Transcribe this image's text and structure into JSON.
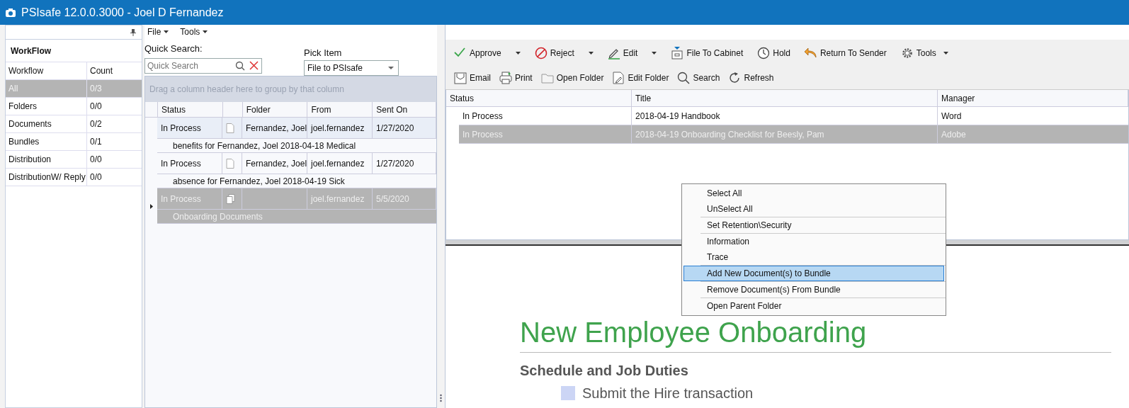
{
  "window": {
    "title": "PSIsafe 12.0.0.3000 - Joel D Fernandez"
  },
  "workflow_panel": {
    "title": "WorkFlow",
    "columns": [
      "Workflow",
      "Count"
    ],
    "rows": [
      {
        "name": "All",
        "count": "0/3",
        "selected": true
      },
      {
        "name": "Folders",
        "count": "0/0",
        "selected": false
      },
      {
        "name": "Documents",
        "count": "0/2",
        "selected": false
      },
      {
        "name": "Bundles",
        "count": "0/1",
        "selected": false
      },
      {
        "name": "Distribution",
        "count": "0/0",
        "selected": false
      },
      {
        "name": "DistributionW/ Reply",
        "count": "0/0",
        "selected": false
      }
    ]
  },
  "menu": [
    {
      "label": "File"
    },
    {
      "label": "Tools"
    }
  ],
  "quick_search": {
    "label": "Quick Search:",
    "placeholder": "Quick Search"
  },
  "pick_item": {
    "label": "Pick Item",
    "value": "File to PSIsafe"
  },
  "inbox_grid": {
    "group_hint": "Drag a column header here to group by that column",
    "columns": [
      "Status",
      "Folder",
      "From",
      "Sent On"
    ],
    "rows": [
      {
        "kind": "document",
        "status": "In Process",
        "folder": "Fernandez, Joel",
        "from": "joel.fernandez",
        "sent_on": "1/27/2020",
        "description": "benefits for Fernandez, Joel 2018-04-18 Medical",
        "focused": true,
        "selected": false
      },
      {
        "kind": "document",
        "status": "In Process",
        "folder": "Fernandez, Joel",
        "from": "joel.fernandez",
        "sent_on": "1/27/2020",
        "description": "absence for Fernandez, Joel 2018-04-19 Sick",
        "focused": false,
        "selected": false
      },
      {
        "kind": "bundle",
        "status": "In Process",
        "from": "joel.fernandez",
        "sent_on": "5/5/2020",
        "description": "Onboarding Documents",
        "focused": false,
        "selected": true
      }
    ]
  },
  "toolbar": [
    {
      "label": "Approve",
      "dropdown": true
    },
    {
      "label": "Reject",
      "dropdown": true
    },
    {
      "label": "Edit",
      "dropdown": true
    },
    {
      "label": "File To Cabinet",
      "dropdown": false
    },
    {
      "label": "Hold",
      "dropdown": false
    },
    {
      "label": "Return To Sender",
      "dropdown": false
    },
    {
      "label": "Tools",
      "dropdown": true
    }
  ],
  "toolbar_2": [
    {
      "label": "Email"
    },
    {
      "label": "Print"
    },
    {
      "label": "Open Folder"
    },
    {
      "label": "Edit Folder"
    },
    {
      "label": "Search"
    },
    {
      "label": "Refresh"
    }
  ],
  "documents_grid": {
    "columns": [
      "Status",
      "Title",
      "Manager"
    ],
    "rows": [
      {
        "status": "In Process",
        "title": "2018-04-19 Handbook",
        "manager": "Word",
        "selected": false
      },
      {
        "status": "In Process",
        "title": "2018-04-19 Onboarding Checklist for Beesly, Pam",
        "manager": "Adobe",
        "selected": true
      }
    ]
  },
  "preview": {
    "heading": "New Employee Onboarding",
    "subheading": "Schedule and Job Duties",
    "items": [
      {
        "text": "Submit the Hire transaction",
        "checked": false
      }
    ]
  },
  "context_menu": {
    "groups": [
      {
        "items": [
          {
            "label": "Select All",
            "selected": false
          },
          {
            "label": "UnSelect All",
            "selected": false
          }
        ]
      },
      {
        "items": [
          {
            "label": "Set Retention\\Security",
            "selected": false
          }
        ]
      },
      {
        "items": [
          {
            "label": "Information",
            "selected": false
          },
          {
            "label": "Trace",
            "selected": false
          }
        ]
      },
      {
        "items": [
          {
            "label": "Add New Document(s) to Bundle",
            "selected": true
          }
        ]
      },
      {
        "items": [
          {
            "label": "Remove Document(s) From Bundle",
            "selected": false
          }
        ]
      },
      {
        "items": [
          {
            "label": "Open Parent Folder",
            "selected": false
          }
        ]
      }
    ]
  }
}
